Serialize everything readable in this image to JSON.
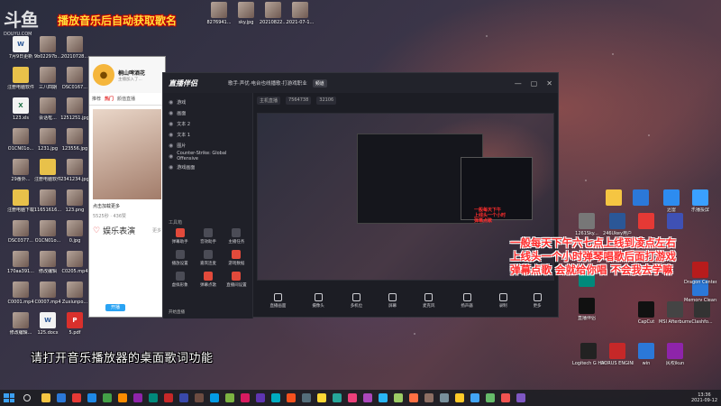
{
  "watermark": {
    "logo": "斗鱼",
    "url": "DOUYU.COM"
  },
  "banner_top": "播放音乐后自动获取歌名",
  "subtitle": "请打开音乐播放器的桌面歌词功能",
  "red_notes": [
    "一般每天下午六七点上线到凌点左右",
    "上线头一个小时弹琴唱歌后面打游戏",
    "弹幕点歌 会就给你唱 不会我去学嘛"
  ],
  "desktop_icons": [
    {
      "label": "",
      "kind": "thumb"
    },
    {
      "label": "",
      "kind": "thumb"
    },
    {
      "label": "",
      "kind": "thumb"
    },
    {
      "label": "",
      "kind": "thumb"
    },
    {
      "label": "8276941...",
      "kind": "thumb"
    },
    {
      "label": "sky.jpg",
      "kind": "thumb"
    },
    {
      "label": "20210822...",
      "kind": "thumb"
    },
    {
      "label": "2021-07-1...",
      "kind": "thumb"
    },
    {
      "label": "7月9日更新",
      "kind": "docx"
    },
    {
      "label": "9b02297b...",
      "kind": "thumb"
    },
    {
      "label": "20210728...",
      "kind": "thumb"
    },
    {
      "label": "注册电脑软件",
      "kind": "folder"
    },
    {
      "label": "三八四期",
      "kind": "thumb"
    },
    {
      "label": "DSC0167...",
      "kind": "thumb"
    },
    {
      "label": "123.xls",
      "kind": "xlsx"
    },
    {
      "label": "会话框...",
      "kind": "thumb"
    },
    {
      "label": "1251251.jpg",
      "kind": "thumb"
    },
    {
      "label": "O1CN01o...",
      "kind": "thumb"
    },
    {
      "label": "1231.jpg",
      "kind": "thumb"
    },
    {
      "label": "123556.jpg",
      "kind": "thumb"
    },
    {
      "label": "29番外...",
      "kind": "thumb"
    },
    {
      "label": "注册电脑软件",
      "kind": "folder"
    },
    {
      "label": "2341234.jpg",
      "kind": "thumb"
    },
    {
      "label": "注册电脑下载",
      "kind": "folder"
    },
    {
      "label": "11651616...",
      "kind": "thumb"
    },
    {
      "label": "123.png",
      "kind": "thumb"
    },
    {
      "label": "DSC0377...",
      "kind": "thumb"
    },
    {
      "label": "O1CN01o...",
      "kind": "thumb"
    },
    {
      "label": "0.jpg",
      "kind": "thumb"
    },
    {
      "label": "170aa391...",
      "kind": "thumb"
    },
    {
      "label": "修改编辑",
      "kind": "thumb"
    },
    {
      "label": "C0205.mp4",
      "kind": "thumb"
    },
    {
      "label": "C0001.mp4",
      "kind": "thumb"
    },
    {
      "label": "C0007.mp4",
      "kind": "thumb"
    },
    {
      "label": "Zuxiunpo...",
      "kind": "thumb"
    },
    {
      "label": "修改编辑...",
      "kind": "thumb"
    },
    {
      "label": "125.docx",
      "kind": "docx"
    },
    {
      "label": "5.pdf",
      "kind": "pdf"
    }
  ],
  "right_icons": [
    {
      "label": "",
      "kind": "exe",
      "color": "#f5c542"
    },
    {
      "label": "",
      "kind": "exe",
      "color": "#2b78d8"
    },
    {
      "label": "迅雷",
      "kind": "exe",
      "color": "#2d8cf0"
    },
    {
      "label": "乐播投屏",
      "kind": "exe",
      "color": "#3aa0ff"
    },
    {
      "label": "1261Sky...",
      "kind": "thumb",
      "color": "#777"
    },
    {
      "label": "246Ukey用户",
      "kind": "exe",
      "color": "#2b5797"
    },
    {
      "label": "",
      "kind": "exe",
      "color": "#e53935"
    },
    {
      "label": "",
      "kind": "exe",
      "color": "#3f51b5"
    },
    {
      "label": "",
      "kind": "exe",
      "color": "#00897b"
    },
    {
      "label": "Memory Cleaner",
      "kind": "exe",
      "color": "#2b78d8"
    },
    {
      "label": "Dragon Center",
      "kind": "exe",
      "color": "#b71c1c"
    },
    {
      "label": "直播伴侣",
      "kind": "exe",
      "color": "#111"
    },
    {
      "label": "CapCut",
      "kind": "exe",
      "color": "#111"
    },
    {
      "label": "MSI Afterburner",
      "kind": "exe",
      "color": "#444"
    },
    {
      "label": "Clashfo...",
      "kind": "exe",
      "color": "#333"
    },
    {
      "label": "Logitech G HUB",
      "kind": "exe",
      "color": "#222"
    },
    {
      "label": "AORUS ENGINE",
      "kind": "exe",
      "color": "#c62828"
    },
    {
      "label": "win",
      "kind": "exe",
      "color": "#2b78d8"
    },
    {
      "label": "风吹ikun",
      "kind": "exe",
      "color": "#8e24aa"
    }
  ],
  "phone": {
    "name": "桐山啤酒花",
    "subtitle": "主播加入了...",
    "tabs": [
      "推荐",
      "热门",
      "颜值直播"
    ],
    "item_caption": "点击加载更多",
    "item_meta": "5525秒 · 436赞",
    "section_title": "娱乐表演",
    "section_link": "更多",
    "footer_btn": "开播"
  },
  "stream": {
    "logo": "直播伴侣",
    "title": "歌手·声优·电台也线播歌·打游戏职业",
    "badge": "频道",
    "window_controls": [
      "—",
      "▢",
      "✕"
    ],
    "info_tags": [
      "主机直播",
      "7564738",
      "32106"
    ],
    "scenes": [
      {
        "label": "游戏"
      },
      {
        "label": "画面"
      },
      {
        "label": "文本 2"
      },
      {
        "label": "文本 1"
      },
      {
        "label": "图片"
      },
      {
        "label": "Counter-Strike: Global Offensive"
      },
      {
        "label": "游戏画面"
      }
    ],
    "tools_header": "工具箱",
    "tools": [
      {
        "label": "弹幕助手",
        "color": "red"
      },
      {
        "label": "音效助手",
        "color": "gray"
      },
      {
        "label": "主播任务",
        "color": "gray"
      },
      {
        "label": "播放设置",
        "color": "gray"
      },
      {
        "label": "嘉宾连麦",
        "color": "gray"
      },
      {
        "label": "游戏数据",
        "color": "red"
      },
      {
        "label": "虚拟形象",
        "color": "gray"
      },
      {
        "label": "弹幕点歌",
        "color": "red"
      },
      {
        "label": "直播间设置",
        "color": "red"
      }
    ],
    "bottom_buttons": [
      "直播画面",
      "摄像头",
      "多机位",
      "屏幕",
      "麦克风",
      "扬声器",
      "录制",
      "更多"
    ],
    "start_live": "开始直播",
    "preview_red": [
      "一般每天下午",
      "上线头一个小时",
      "弹幕点歌"
    ]
  },
  "taskbar": {
    "time": "13:36",
    "date": "2021-09-12",
    "apps": [
      "#f5c542",
      "#2b78d8",
      "#e53935",
      "#1e88e5",
      "#43a047",
      "#fb8c00",
      "#8e24aa",
      "#00897b",
      "#c62828",
      "#3949ab",
      "#6d4c41",
      "#039be5",
      "#7cb342",
      "#d81b60",
      "#5e35b1",
      "#00acc1",
      "#f4511e",
      "#546e7a",
      "#fdd835",
      "#26a69a",
      "#ec407a",
      "#ab47bc",
      "#29b6f6",
      "#9ccc65",
      "#ff7043",
      "#8d6e63",
      "#78909c",
      "#ffca28",
      "#42a5f5",
      "#66bb6a",
      "#ef5350",
      "#7e57c2"
    ]
  }
}
